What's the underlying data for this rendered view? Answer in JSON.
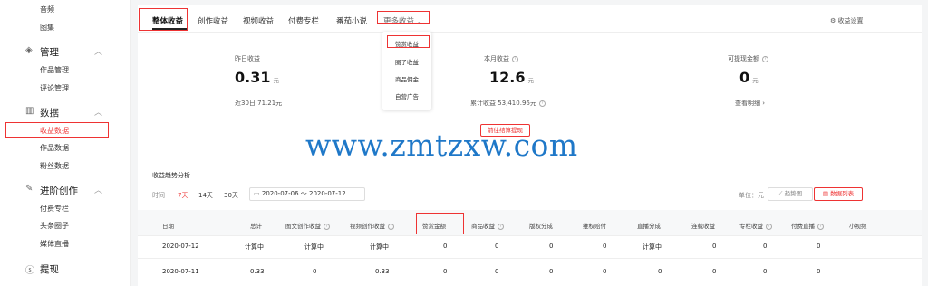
{
  "sidebar": {
    "items": [
      {
        "label": "音频"
      },
      {
        "label": "图集"
      },
      {
        "label": "管理",
        "icon": "layers-icon"
      },
      {
        "label": "作品管理"
      },
      {
        "label": "评论管理"
      },
      {
        "label": "数据",
        "icon": "bar-chart-icon"
      },
      {
        "label": "收益数据"
      },
      {
        "label": "作品数据"
      },
      {
        "label": "粉丝数据"
      },
      {
        "label": "进阶创作",
        "icon": "edit-icon"
      },
      {
        "label": "付费专栏"
      },
      {
        "label": "头条圈子"
      },
      {
        "label": "媒体直播"
      },
      {
        "label": "提现",
        "icon": "coin-icon"
      }
    ]
  },
  "tabs": [
    "整体收益",
    "创作收益",
    "视频收益",
    "付费专栏",
    "番茄小说",
    "更多收益"
  ],
  "settings_label": "收益设置",
  "dropdown": [
    "赞赏收益",
    "圈子收益",
    "商品佣金",
    "自营广告"
  ],
  "stats": {
    "yesterday": {
      "label": "昨日收益",
      "value": "0.31",
      "unit": "元",
      "footer": "近30日 71.21元"
    },
    "month": {
      "label": "本月收益",
      "value": "12.6",
      "unit": "元",
      "footer": "累计收益 53,410.96元"
    },
    "withdrawable": {
      "label": "可提现金额",
      "value": "0",
      "unit": "元",
      "footer": "查看明细 ›"
    }
  },
  "withdraw_button": "前往结算提现",
  "watermark": "www.zmtzxw.com",
  "trend": {
    "title": "收益趋势分析",
    "time_label": "时间",
    "ranges": [
      "7天",
      "14天",
      "30天"
    ],
    "date_range": "2020-07-06 ～ 2020-07-12",
    "unit": "单位：元",
    "view_trend": "趋势图",
    "view_table": "数据列表"
  },
  "table": {
    "headers": [
      "日期",
      "总计",
      "图文创作收益",
      "视频创作收益",
      "赞赏金额",
      "商品收益",
      "版权分成",
      "维权赔付",
      "直播分成",
      "连载收益",
      "专栏收益",
      "付费直播",
      "小视频"
    ],
    "rows": [
      [
        "2020-07-12",
        "计算中",
        "计算中",
        "计算中",
        "0",
        "0",
        "0",
        "0",
        "计算中",
        "0",
        "0",
        "0"
      ],
      [
        "2020-07-11",
        "0.33",
        "0",
        "0.33",
        "0",
        "0",
        "0",
        "0",
        "0",
        "0",
        "0",
        "0"
      ]
    ]
  },
  "colors": {
    "accent": "#e33333",
    "watermark": "#1f78c8"
  }
}
